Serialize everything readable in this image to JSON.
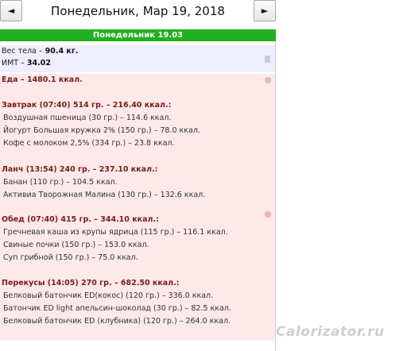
{
  "nav": {
    "prev_label": "◄",
    "next_label": "►"
  },
  "date_title": "Понедельник, Мар 19, 2018",
  "day_bar": "Понедельник 19.03",
  "body": {
    "weight_label": "Вес тела – ",
    "weight_value": "90.4 кг.",
    "bmi_label": "ИМТ – ",
    "bmi_value": "34.02"
  },
  "food": {
    "total_label": "Еда – ",
    "total_value": "1480.1 ккал.",
    "meals": [
      {
        "header": "Завтрак (07:40) 514 гр. – 216.40 ккал.:",
        "items": [
          "Воздушная пшеница (30 гр.) – 114.6 ккал.",
          "Йогурт Большая кружка 2% (150 гр.) – 78.0 ккал.",
          "Кофе с молоком 2,5% (334 гр.) – 23.8 ккал."
        ]
      },
      {
        "header": "Ланч (13:54) 240 гр. – 237.10 ккал.:",
        "items": [
          "Банан (110 гр.) – 104.5 ккал.",
          "Активиа Творожная Малина (130 гр.) – 132.6 ккал."
        ]
      },
      {
        "header": "Обед (07:40) 415 гр. – 344.10 ккал.:",
        "items": [
          "Гречневая каша из крупы ядрица (115 гр.) – 116.1 ккал.",
          "Свиные почки (150 гр.) – 153.0 ккал.",
          "Суп грибной (150 гр.) – 75.0 ккал."
        ]
      },
      {
        "header": "Перекусы (14:05) 270 гр. – 682.50 ккал.:",
        "items": [
          "Белковый батончик ED(кокос) (120 гр.) – 336.0 ккал.",
          "Батончик ED light апельсин-шоколад (30 гр.) – 82.5 ккал.",
          "Белковый батончик ED (клубника) (120 гр.) – 264.0 ккал."
        ]
      }
    ]
  },
  "watermark": "Calorizator.ru",
  "colors": {
    "day_bar": "#20b020",
    "body_bg": "#eeeeff",
    "food_bg": "#fde9e9",
    "meal_header": "#7a1c1c"
  }
}
